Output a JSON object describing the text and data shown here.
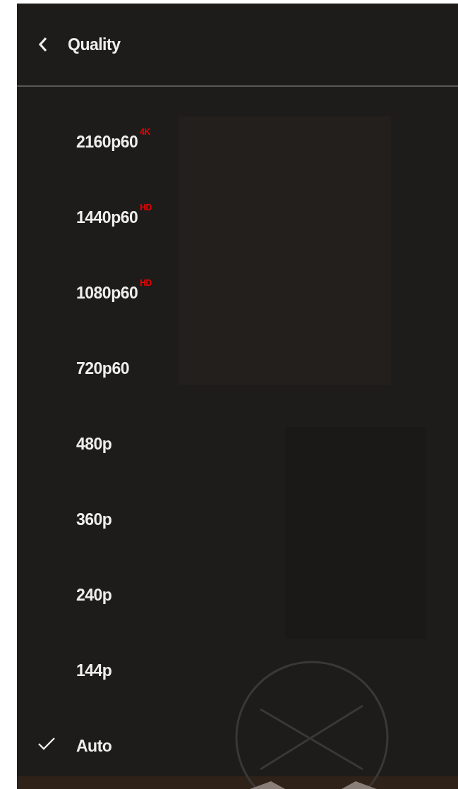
{
  "menu": {
    "title": "Quality",
    "items": [
      {
        "label": "2160p60",
        "badge": "4K",
        "selected": false
      },
      {
        "label": "1440p60",
        "badge": "HD",
        "selected": false
      },
      {
        "label": "1080p60",
        "badge": "HD",
        "selected": false
      },
      {
        "label": "720p60",
        "selected": false
      },
      {
        "label": "480p",
        "selected": false
      },
      {
        "label": "360p",
        "selected": false
      },
      {
        "label": "240p",
        "selected": false
      },
      {
        "label": "144p",
        "selected": false
      },
      {
        "label": "Auto",
        "selected": true
      }
    ]
  }
}
